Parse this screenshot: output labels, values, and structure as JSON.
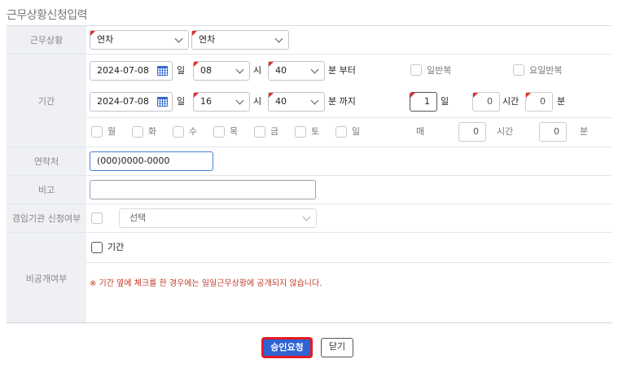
{
  "page_title": "근무상황신청입력",
  "work_status": {
    "label": "근무상황",
    "select1": "연차",
    "select2": "연차"
  },
  "period": {
    "label": "기간",
    "start": {
      "date": "2024-07-08",
      "day_unit": "일",
      "hour": "08",
      "hour_unit": "시",
      "minute": "40",
      "minute_suffix": "분 부터",
      "half_day_label": "일반복",
      "weekday_half_label": "요일반복"
    },
    "end": {
      "date": "2024-07-08",
      "day_unit": "일",
      "hour": "16",
      "hour_unit": "시",
      "minute": "40",
      "minute_suffix": "분 까지",
      "total_days": "1",
      "total_days_unit": "일",
      "total_hours": "0",
      "total_hours_unit": "시간",
      "total_minutes": "0",
      "total_minutes_unit": "분"
    },
    "weekdays": [
      "월",
      "화",
      "수",
      "목",
      "금",
      "토",
      "일"
    ],
    "every_label": "매",
    "every_hours": "0",
    "every_hours_unit": "시간",
    "every_minutes": "0",
    "every_minutes_unit": "분"
  },
  "contact": {
    "label": "연락처",
    "value": "(000)0000-0000"
  },
  "remark": {
    "label": "비고",
    "value": ""
  },
  "concurrent": {
    "label": "겸임기관 신청여부",
    "select_placeholder": "선택"
  },
  "private": {
    "label": "비공개여부",
    "checkbox_label": "기간",
    "notice": "※ 기간 옆에 체크를 한 경우에는 일일근무상황에 공개되지 않습니다."
  },
  "buttons": {
    "approve": "승인요청",
    "close": "닫기"
  },
  "colors": {
    "primary": "#2f63d4",
    "highlight": "#e31b23",
    "notice": "#c0392b",
    "label_bg": "#eef0f4"
  }
}
